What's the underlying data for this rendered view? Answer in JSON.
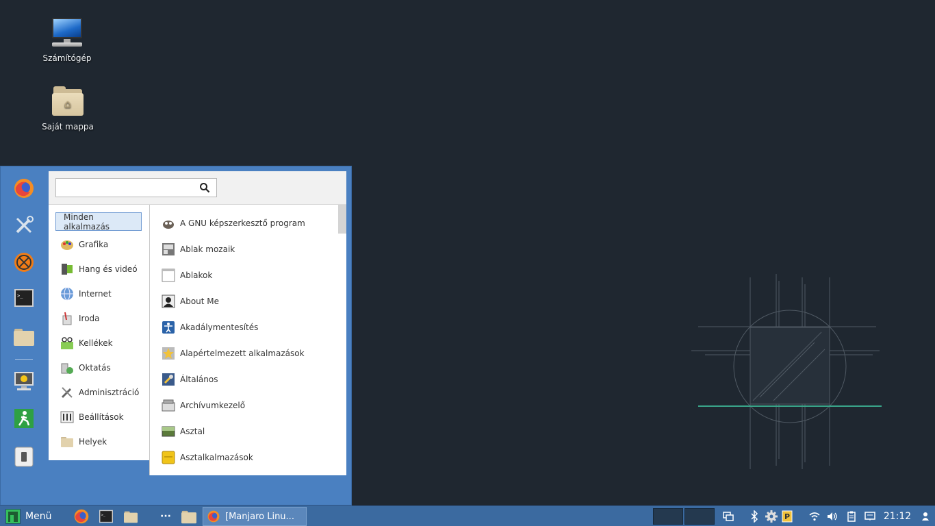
{
  "desktop": {
    "icons": [
      {
        "label": "Számítógép",
        "icon": "computer-icon"
      },
      {
        "label": "Saját mappa",
        "icon": "home-folder-icon"
      }
    ]
  },
  "menu": {
    "search": {
      "value": "",
      "placeholder": ""
    },
    "favorites": [
      "firefox-icon",
      "tools-icon",
      "hexchat-icon",
      "terminal-icon",
      "folder-icon",
      "lock-screen-icon",
      "logout-icon",
      "suspend-icon"
    ],
    "categories": [
      {
        "label": "Minden alkalmazás",
        "active": true
      },
      {
        "label": "Grafika"
      },
      {
        "label": "Hang és videó"
      },
      {
        "label": "Internet"
      },
      {
        "label": "Iroda"
      },
      {
        "label": "Kellékek"
      },
      {
        "label": "Oktatás"
      },
      {
        "label": "Adminisztráció"
      },
      {
        "label": "Beállítások"
      },
      {
        "label": "Helyek"
      }
    ],
    "apps": [
      {
        "label": "A GNU képszerkesztő program"
      },
      {
        "label": "Ablak mozaik"
      },
      {
        "label": "Ablakok"
      },
      {
        "label": "About Me"
      },
      {
        "label": "Akadálymentesítés"
      },
      {
        "label": "Alapértelmezett alkalmazások"
      },
      {
        "label": "Általános"
      },
      {
        "label": "Archívumkezelő"
      },
      {
        "label": "Asztal"
      },
      {
        "label": "Asztalkalmazások"
      }
    ]
  },
  "taskbar": {
    "menu_label": "Menü",
    "window_title": "[Manjaro Linu...",
    "clock": "21:12",
    "accent": "#35bf5c"
  }
}
